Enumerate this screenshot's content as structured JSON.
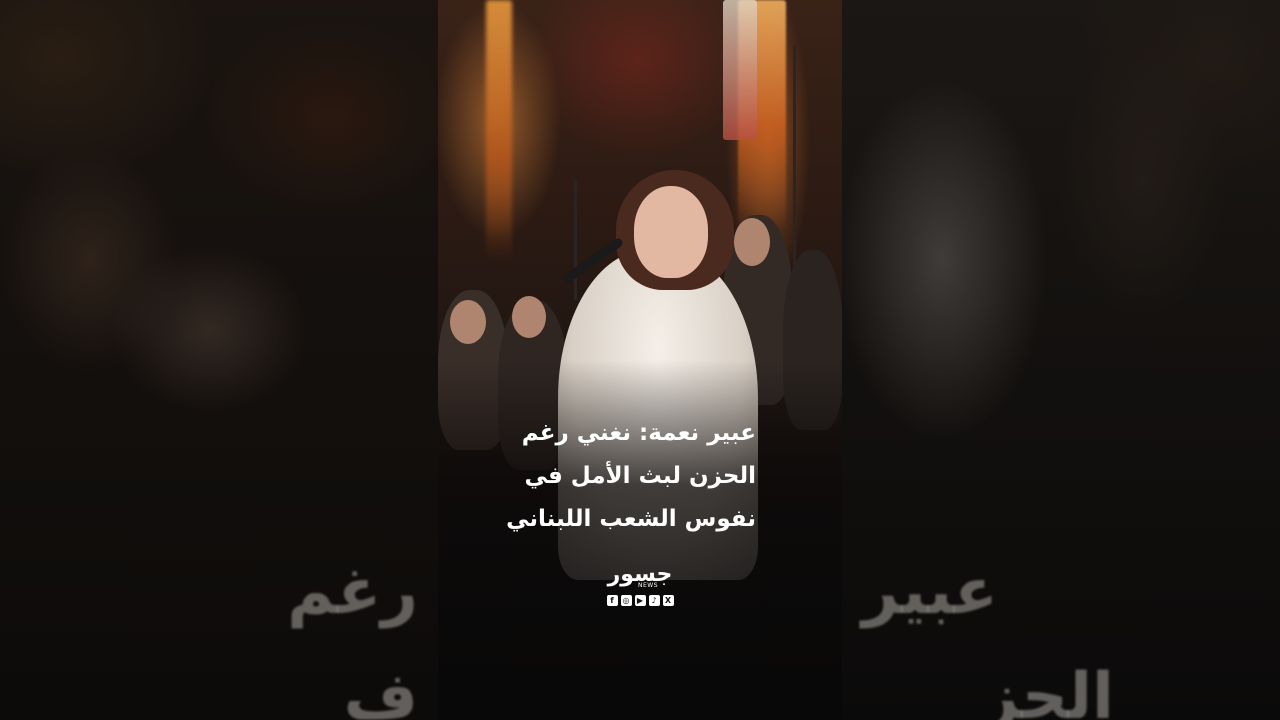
{
  "headline": {
    "line1": "عبير نعمة: نغني رغم",
    "line2": "الحزن لبث الأمل في",
    "line3": "نفوس الشعب اللبناني"
  },
  "background_text": {
    "left_line1": "رغم",
    "left_line2": "ف",
    "right_line1": "عبير",
    "right_line2": "الحز"
  },
  "brand": {
    "logo_text": "جسور",
    "logo_sub": "NEWS"
  },
  "socials": [
    {
      "icon": "facebook-icon",
      "glyph": "f"
    },
    {
      "icon": "instagram-icon",
      "glyph": "◎"
    },
    {
      "icon": "youtube-icon",
      "glyph": "▶"
    },
    {
      "icon": "tiktok-icon",
      "glyph": "♪"
    },
    {
      "icon": "x-icon",
      "glyph": "X"
    }
  ]
}
